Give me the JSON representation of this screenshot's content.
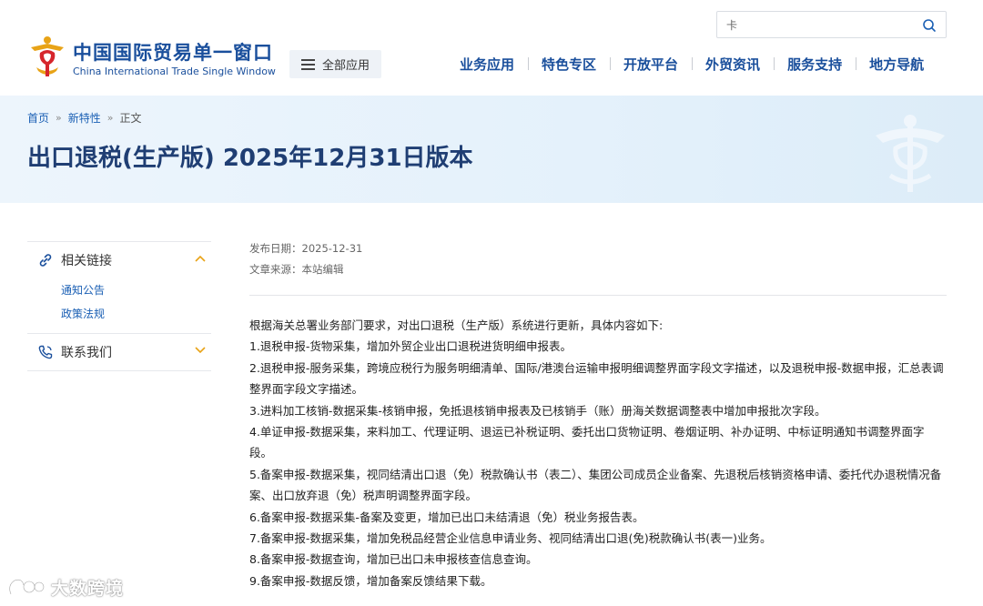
{
  "header": {
    "brand_cn": "中国国际贸易单一窗口",
    "brand_en": "China International Trade Single Window",
    "all_apps_label": "全部应用",
    "search": {
      "value": "卡",
      "placeholder": ""
    },
    "nav": [
      "业务应用",
      "特色专区",
      "开放平台",
      "外贸资讯",
      "服务支持",
      "地方导航"
    ]
  },
  "breadcrumb": {
    "home": "首页",
    "section": "新特性",
    "current": "正文",
    "separator": "»"
  },
  "page_title": "出口退税(生产版) 2025年12月31日版本",
  "sidebar": {
    "groups": [
      {
        "label": "相关链接",
        "icon": "link-icon",
        "expanded": true,
        "items": [
          "通知公告",
          "政策法规"
        ]
      },
      {
        "label": "联系我们",
        "icon": "phone-icon",
        "expanded": false,
        "items": []
      }
    ]
  },
  "meta": {
    "publish_date": "发布日期：2025-12-31",
    "source": "文章来源：本站编辑"
  },
  "article": {
    "paragraphs": [
      "根据海关总署业务部门要求，对出口退税（生产版）系统进行更新，具体内容如下:",
      "1.退税申报-货物采集，增加外贸企业出口退税进货明细申报表。",
      "2.退税申报-服务采集，跨境应税行为服务明细清单、国际/港澳台运输申报明细调整界面字段文字描述，以及退税申报-数据申报，汇总表调整界面字段文字描述。",
      "3.进料加工核销-数据采集-核销申报，免抵退核销申报表及已核销手（账）册海关数据调整表中增加申报批次字段。",
      "4.单证申报-数据采集，来料加工、代理证明、退运已补税证明、委托出口货物证明、卷烟证明、补办证明、中标证明通知书调整界面字段。",
      "5.备案申报-数据采集，视同结清出口退（免）税款确认书（表二）、集团公司成员企业备案、先退税后核销资格申请、委托代办退税情况备案、出口放弃退（免）税声明调整界面字段。",
      "6.备案申报-数据采集-备案及变更，增加已出口未结清退（免）税业务报告表。",
      "7.备案申报-数据采集，增加免税品经营企业信息申请业务、视同结清出口退(免)税款确认书(表一)业务。",
      "8.备案申报-数据查询，增加已出口未申报核查信息查询。",
      "9.备案申报-数据反馈，增加备案反馈结果下载。"
    ]
  },
  "watermark": {
    "text": "大数跨境"
  },
  "colors": {
    "brand_blue": "#1a4f9c",
    "link_blue": "#1a5fb4",
    "title_navy": "#1f3e73",
    "banner_bg": "#e6f2fb",
    "logo_gold": "#e8a317",
    "logo_red": "#d6262c"
  }
}
